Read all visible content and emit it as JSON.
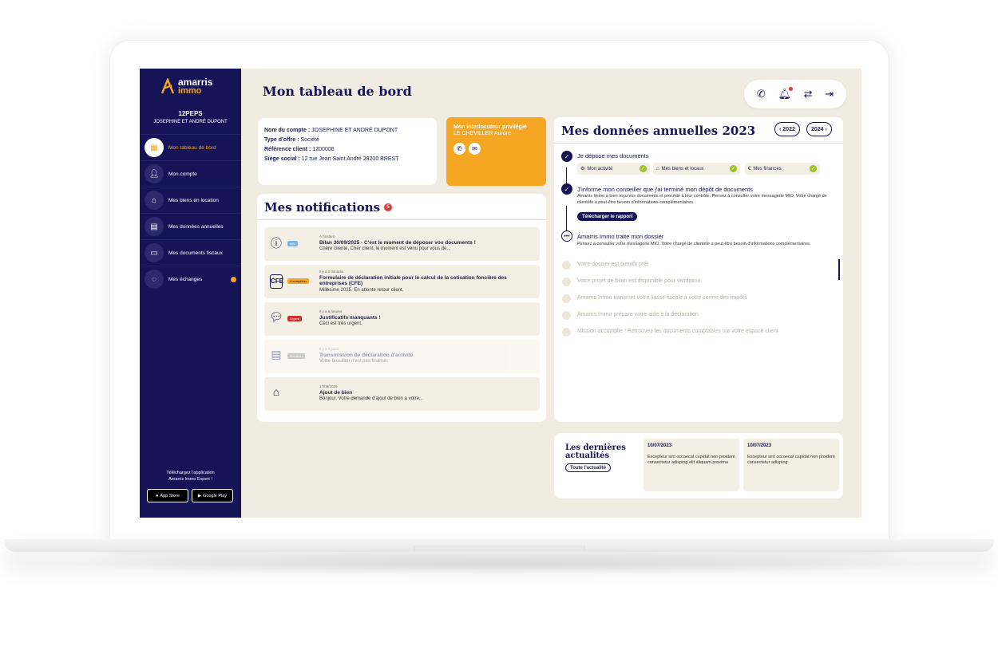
{
  "brand": {
    "line1": "amarris",
    "line2": "immo",
    "accent": "#f5a623",
    "navy": "#141456"
  },
  "account": {
    "code": "12PEPS",
    "name": "JOSEPHINE ET ANDRÉ DUPONT"
  },
  "nav": [
    {
      "label": "Mon tableau de bord",
      "icon": "dashboard-icon",
      "active": true
    },
    {
      "label": "Mon compte",
      "icon": "user-icon"
    },
    {
      "label": "Mes biens en location",
      "icon": "house-icon"
    },
    {
      "label": "Mes données annuelles",
      "icon": "calendar-icon"
    },
    {
      "label": "Mes documents fiscaux",
      "icon": "folder-icon"
    },
    {
      "label": "Mes échanges",
      "icon": "chat-icon",
      "badge": true
    }
  ],
  "app_promo": {
    "line1": "Téléchargez l'application",
    "line2": "Amarris Immo Expert !",
    "appstore": "App Store",
    "googleplay": "Google Play"
  },
  "page_title": "Mon tableau de bord",
  "account_info": {
    "label_name": "Nom du compte :",
    "value_name": "JOSEPHINE ET ANDRÉ DUPONT",
    "label_offer": "Type d'offre :",
    "value_offer": "Société",
    "label_ref": "Référence client :",
    "value_ref": "1200006",
    "label_seat": "Siège social :",
    "value_seat": "12 rue Jean Saint André 29200 BREST"
  },
  "contact": {
    "title": "Mon interlocuteur privilégié",
    "name": "LE CHEVILLER Aurore"
  },
  "notifications": {
    "title": "Mes notifications",
    "count": "5",
    "items": [
      {
        "tag": "Info",
        "meta": "A l'instant",
        "title": "Bilan 30/09/2025 - C'est le moment  de déposer vos documents !",
        "body": "Chère cliente, Cher client, le moment est venu pour vous de..."
      },
      {
        "tag": "A compléter",
        "meta": "Il y a 2 minutes",
        "title": "Formulaire de déclaration initiale pour le calcul de la cotisation foncière des entreprises (CFE)",
        "body": "Millésime 2025. En attente retour client."
      },
      {
        "tag": "Urgent",
        "meta": "Il y a 6 heures",
        "title": "Justificatifs manquants !",
        "body": "Ceci est très urgent."
      },
      {
        "tag": "Brouillon",
        "meta": "Il y a 3 jours",
        "title": "Transmission de déclaration d'activité",
        "body": "Votre brouillon n'est pas finalisé."
      },
      {
        "tag": "",
        "meta": "17/09/2025",
        "title": "Ajout de bien",
        "body": "Bonjour, Votre demande d'ajout de bien a votre..."
      }
    ]
  },
  "annual": {
    "title": "Mes données annuelles 2023",
    "prev_year": "2022",
    "next_year": "2024",
    "step1": {
      "title": "Je dépose mes documents",
      "chips": [
        "Mon activité",
        "Mes biens et locaux",
        "Mes finances"
      ]
    },
    "step2": {
      "title": "J'informe mon conseiller que j'ai terminé mon dépôt de documents",
      "desc": "Amarris Immo a bien reçu vos documents et procède à leur contrôle. Pensez à consulter votre messagerie MIO. Votre chargé de clientèle a peut-être besoin d'informations complémentaires.",
      "button": "Télécharger le rapport"
    },
    "step3": {
      "title": "Amarris Immo traite mon dossier",
      "desc": "Pensez à consulter votre messagerie MIO. Votre chargé de clientèle a peut-être besoin d'informations complémentaires."
    },
    "pending": [
      "Votre dossier est bientôt prêt",
      "Votre projet de bilan est disponible pour validation",
      "Amarris Immo transmet votre liasse fiscale à votre centre des impôts",
      "Amarris Immo prépare votre aide à la déclaration",
      "Mission accomplie ! Retrouvez les documents comptables sur votre espace client"
    ]
  },
  "news": {
    "title": "Les dernières actualités",
    "button": "Toute l'actualité",
    "items": [
      {
        "date": "10/07/2023",
        "text": "Excepteur sint occaecat cupidat non proident consectetur adisping elit aliquam proxima"
      },
      {
        "date": "10/07/2023",
        "text": "Excepteur sint occaecat cupidat non proident consectetur adisping"
      }
    ]
  }
}
